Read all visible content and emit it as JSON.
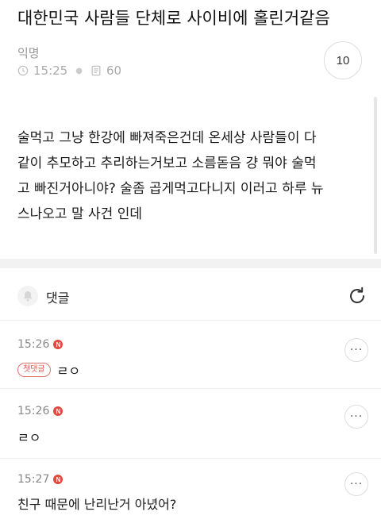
{
  "post": {
    "title": "대한민국 사람들 단체로 사이비에 홀린거같음",
    "author": "익명",
    "time": "15:25",
    "views": "60",
    "comment_count": "10",
    "body_lines": [
      "술먹고 그냥 한강에 빠져죽은건데 온세상 사람들이 다",
      "같이 추모하고 추리하는거보고 소름돋음 걍 뭐야 술먹",
      "고 빠진거아니야? 술좀 곱게먹고다니지 이러고 하루 뉴",
      "스나오고 말 사건 인데"
    ]
  },
  "icons": {
    "time": "clock-icon",
    "views": "document-icon",
    "comments": "bell-icon",
    "refresh": "refresh-icon",
    "more": "more-dots-icon"
  },
  "comments_section": {
    "label": "댓글",
    "items": [
      {
        "time": "15:26",
        "badge": "N",
        "op_label": "첫댓글",
        "text": "ㄹㅇ",
        "more": "···"
      },
      {
        "time": "15:26",
        "badge": "N",
        "text": "ㄹㅇ",
        "more": "···"
      },
      {
        "time": "15:27",
        "badge": "N",
        "text": "친구 때문에 난리난거 아녔어?",
        "more": "···"
      }
    ]
  },
  "colors": {
    "badge_red": "#e04a3f",
    "separator": "#f2f2f2",
    "muted_text": "#999999"
  }
}
